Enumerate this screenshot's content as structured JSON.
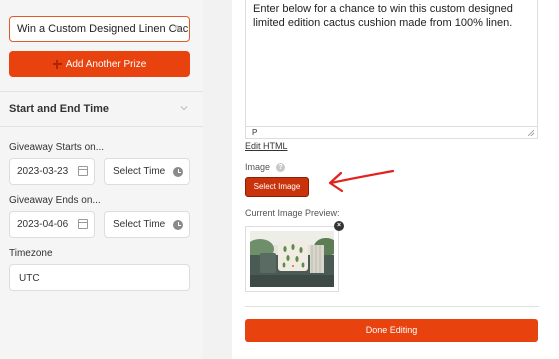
{
  "prizes": {
    "prize_name_value": "Win a Custom Designed Linen Cac…",
    "add_prize_label": "Add Another Prize"
  },
  "schedule": {
    "section_title": "Start and End Time",
    "start_label": "Giveaway Starts on...",
    "start_date": "2023-03-23",
    "start_time_placeholder": "Select Time",
    "end_label": "Giveaway Ends on...",
    "end_date": "2023-04-06",
    "end_time_placeholder": "Select Time",
    "timezone_label": "Timezone",
    "timezone_value": "UTC"
  },
  "editor": {
    "body_text": "Enter below for a chance to win this custom designed limited edition cactus cushion made from 100% linen.",
    "status_path": "P",
    "edit_html_label": "Edit HTML"
  },
  "image": {
    "label": "Image",
    "help_glyph": "?",
    "select_label": "Select Image",
    "preview_label": "Current Image Preview:",
    "remove_glyph": "×"
  },
  "footer": {
    "done_label": "Done Editing"
  },
  "colors": {
    "accent": "#e8420f",
    "select_button": "#c9330c",
    "annotation_arrow": "#e0231c"
  }
}
